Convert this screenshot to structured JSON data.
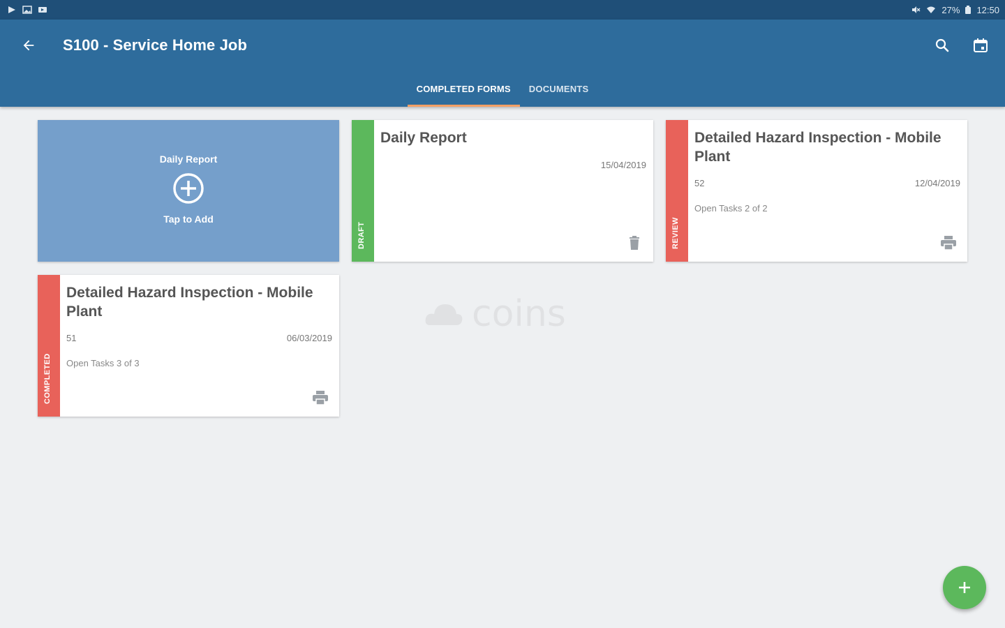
{
  "status_bar": {
    "left_icons": [
      "play-store-icon",
      "image-icon",
      "media-icon"
    ],
    "right_icons": [
      "mute-icon",
      "wifi-icon"
    ],
    "battery_text": "27%",
    "time": "12:50"
  },
  "app_bar": {
    "title": "S100 - Service Home Job",
    "back_icon": "arrow-left-icon",
    "search_icon": "search-icon",
    "calendar_icon": "calendar-icon",
    "color": "#2e6c9c"
  },
  "tabs": [
    {
      "label": "COMPLETED FORMS",
      "active": true
    },
    {
      "label": "DOCUMENTS",
      "active": false
    }
  ],
  "watermark": {
    "text": "coins"
  },
  "add_card": {
    "title": "Daily Report",
    "subtitle": "Tap to Add",
    "icon": "plus-circle-icon",
    "color": "#759fcb"
  },
  "cards": [
    {
      "title": "Daily Report",
      "date": "15/04/2019",
      "number": "",
      "tasks": "",
      "status": "DRAFT",
      "status_color": "#5cb85c",
      "action_icon": "trash-icon"
    },
    {
      "title": "Detailed Hazard Inspection - Mobile Plant",
      "date": "12/04/2019",
      "number": "52",
      "tasks": "Open Tasks 2 of 2",
      "status": "REVIEW",
      "status_color": "#e8625a",
      "action_icon": "printer-icon"
    },
    {
      "title": "Detailed Hazard Inspection - Mobile Plant",
      "date": "06/03/2019",
      "number": "51",
      "tasks": "Open Tasks 3 of 3",
      "status": "COMPLETED",
      "status_color": "#e8625a",
      "action_icon": "printer-icon"
    }
  ],
  "fab": {
    "icon": "plus-icon",
    "color": "#5cb85c"
  }
}
